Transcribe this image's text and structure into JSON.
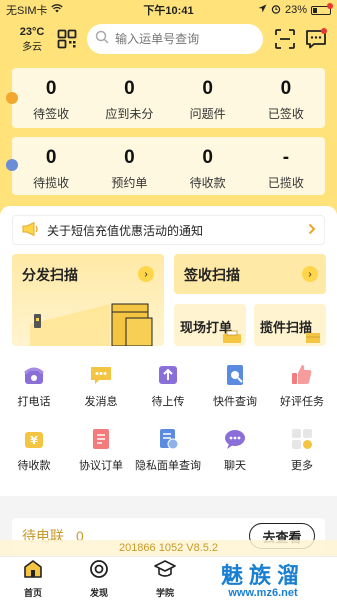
{
  "status": {
    "carrier": "无SIM卡",
    "time": "下午10:41",
    "battery": "23%"
  },
  "header": {
    "temperature": "23°C",
    "weather": "多云",
    "search_placeholder": "输入运单号查询"
  },
  "stats_row1": [
    {
      "value": "0",
      "label": "待签收"
    },
    {
      "value": "0",
      "label": "应到未分"
    },
    {
      "value": "0",
      "label": "问题件"
    },
    {
      "value": "0",
      "label": "已签收"
    }
  ],
  "stats_row2": [
    {
      "value": "0",
      "label": "待揽收"
    },
    {
      "value": "0",
      "label": "预约单"
    },
    {
      "value": "0",
      "label": "待收款"
    },
    {
      "value": "-",
      "label": "已揽收"
    }
  ],
  "notice": {
    "text": "关于短信充值优惠活动的通知"
  },
  "tiles": {
    "dispatch": "分发扫描",
    "sign": "签收扫描",
    "onsite_print": "现场打单",
    "pickup": "揽件扫描"
  },
  "grid": [
    {
      "label": "打电话",
      "icon": "phone-icon"
    },
    {
      "label": "发消息",
      "icon": "message-icon"
    },
    {
      "label": "待上传",
      "icon": "upload-icon"
    },
    {
      "label": "快件查询",
      "icon": "parcel-search-icon"
    },
    {
      "label": "好评任务",
      "icon": "thumbs-up-icon"
    },
    {
      "label": "待收款",
      "icon": "payment-icon"
    },
    {
      "label": "协议订单",
      "icon": "agreement-icon"
    },
    {
      "label": "隐私面单查询",
      "icon": "privacy-waybill-icon"
    },
    {
      "label": "聊天",
      "icon": "chat-icon"
    },
    {
      "label": "更多",
      "icon": "more-icon"
    }
  ],
  "pending": {
    "title": "待电联",
    "count": "0",
    "button": "去查看"
  },
  "version": "201866  1052  V8.5.2",
  "tabs": [
    {
      "label": "首页"
    },
    {
      "label": "发现"
    },
    {
      "label": "学院"
    }
  ],
  "watermark": {
    "brand": "魅族溜",
    "url": "www.mz6.net"
  },
  "colors": {
    "brand_yellow": "#ffe27a",
    "accent_gold": "#c89a2a",
    "watermark_blue": "#1a7fd0"
  }
}
